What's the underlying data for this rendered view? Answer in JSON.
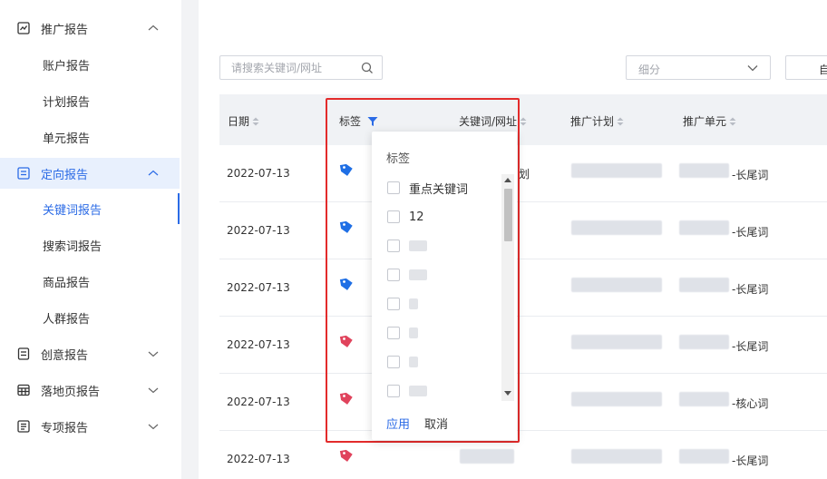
{
  "sidebar": {
    "items": [
      {
        "label": "推广报告",
        "type": "group",
        "icon": "chart-report-icon",
        "expanded": true
      },
      {
        "label": "账户报告",
        "type": "sub"
      },
      {
        "label": "计划报告",
        "type": "sub"
      },
      {
        "label": "单元报告",
        "type": "sub"
      },
      {
        "label": "定向报告",
        "type": "group",
        "icon": "target-report-icon",
        "expanded": true,
        "active": true
      },
      {
        "label": "关键词报告",
        "type": "sub",
        "active": true
      },
      {
        "label": "搜索词报告",
        "type": "sub"
      },
      {
        "label": "商品报告",
        "type": "sub"
      },
      {
        "label": "人群报告",
        "type": "sub"
      },
      {
        "label": "创意报告",
        "type": "group",
        "icon": "creative-report-icon",
        "expanded": false
      },
      {
        "label": "落地页报告",
        "type": "group",
        "icon": "landing-page-icon",
        "expanded": false
      },
      {
        "label": "专项报告",
        "type": "group",
        "icon": "special-report-icon",
        "expanded": false
      }
    ]
  },
  "toolbar": {
    "search_placeholder": "请搜索关键词/网址",
    "breakdown_placeholder": "细分",
    "edge_button_label": "自"
  },
  "table": {
    "columns": [
      "日期",
      "标签",
      "关键词/网址",
      "推广计划",
      "推广单元"
    ],
    "rows": [
      {
        "date": "2022-07-13",
        "tag_color": "#1f6fe5",
        "keyword_tail": "划",
        "unit": "-长尾词"
      },
      {
        "date": "2022-07-13",
        "tag_color": "#1f6fe5",
        "keyword_tail": "",
        "unit": "-长尾词"
      },
      {
        "date": "2022-07-13",
        "tag_color": "#1f6fe5",
        "keyword_tail": "",
        "unit": "-长尾词"
      },
      {
        "date": "2022-07-13",
        "tag_color": "#e0435c",
        "keyword_tail": "",
        "unit": "-长尾词"
      },
      {
        "date": "2022-07-13",
        "tag_color": "#e0435c",
        "keyword_tail": "",
        "unit": "-核心词"
      },
      {
        "date": "2022-07-13",
        "tag_color": "#e0435c",
        "keyword_tail": "",
        "unit": "-长尾词"
      }
    ]
  },
  "tag_filter": {
    "title": "标签",
    "options": [
      "重点关键词",
      "12"
    ],
    "apply_label": "应用",
    "cancel_label": "取消"
  },
  "colors": {
    "accent": "#2b6be6",
    "highlight_border": "#e32b2b",
    "tag_blue": "#1f6fe5",
    "tag_red": "#e0435c"
  }
}
